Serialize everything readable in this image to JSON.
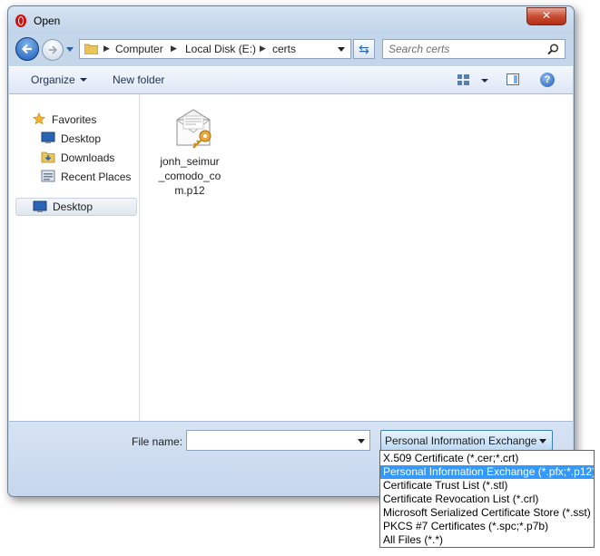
{
  "window": {
    "title": "Open",
    "close_label": "✕"
  },
  "address": {
    "crumbs": [
      "Computer",
      "Local Disk (E:)",
      "certs"
    ]
  },
  "search": {
    "placeholder": "Search certs"
  },
  "toolbar": {
    "organize_label": "Organize",
    "new_folder_label": "New folder",
    "help_label": "?"
  },
  "nav": {
    "favorites_label": "Favorites",
    "favorites": [
      {
        "label": "Desktop",
        "icon": "desktop-icon"
      },
      {
        "label": "Downloads",
        "icon": "downloads-folder-icon"
      },
      {
        "label": "Recent Places",
        "icon": "recent-places-icon"
      }
    ],
    "desktop_label": "Desktop"
  },
  "files": [
    {
      "name": "jonh_seimur_comodo_com.p12",
      "icon": "certificate-file-icon"
    }
  ],
  "bottom": {
    "file_name_label": "File name:",
    "file_name_value": "",
    "file_type_selected": "Personal Information Exchange"
  },
  "file_type_options": [
    "X.509 Certificate (*.cer;*.crt)",
    "Personal Information Exchange (*.pfx;*.p12)",
    "Certificate Trust List (*.stl)",
    "Certificate Revocation List (*.crl)",
    "Microsoft Serialized Certificate Store (*.sst)",
    "PKCS #7 Certificates (*.spc;*.p7b)",
    "All Files (*.*)"
  ],
  "file_type_highlighted_index": 1,
  "colors": {
    "selection": "#3399ff",
    "window_frame": "#c4d6ea",
    "app_icon": "#d11010"
  }
}
